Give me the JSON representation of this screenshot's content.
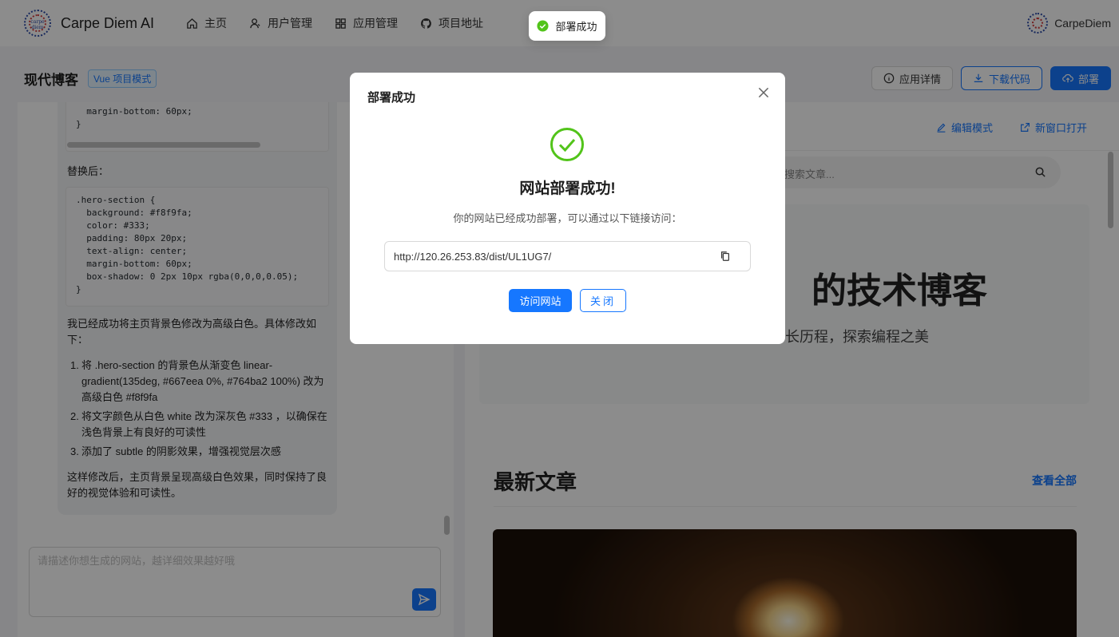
{
  "header": {
    "logo_text": "carpe diem",
    "brand": "Carpe Diem AI",
    "nav": [
      {
        "label": "主页",
        "icon": "home-icon"
      },
      {
        "label": "用户管理",
        "icon": "user-icon"
      },
      {
        "label": "应用管理",
        "icon": "apps-icon"
      },
      {
        "label": "项目地址",
        "icon": "github-icon"
      }
    ],
    "user_name": "CarpeDiem"
  },
  "subbar": {
    "app_title": "现代博客",
    "mode_tag": "Vue 项目模式",
    "details_label": "应用详情",
    "download_label": "下载代码",
    "deploy_label": "部署"
  },
  "chat": {
    "code_top": "  margin-bottom: 60px;\n}",
    "replace_label": "替换后：",
    "code_after": ".hero-section {\n  background: #f8f9fa;\n  color: #333;\n  padding: 80px 20px;\n  text-align: center;\n  margin-bottom: 60px;\n  box-shadow: 0 2px 10px rgba(0,0,0,0.05);\n}",
    "summary": "我已经成功将主页背景色修改为高级白色。具体修改如下：",
    "items": [
      {
        "num": "1.",
        "text": "将 .hero-section 的背景色从渐变色 linear-gradient(135deg, #667eea 0%, #764ba2 100%) 改为高级白色 #f8f9fa"
      },
      {
        "num": "2.",
        "text": "将文字颜色从白色 white 改为深灰色 #333 ，以确保在浅色背景上有良好的可读性"
      },
      {
        "num": "3.",
        "text": "添加了 subtle 的阴影效果，增强视觉层次感"
      }
    ],
    "conclusion": "这样修改后，主页背景呈现高级白色效果，同时保持了良好的视觉体验和可读性。",
    "input_placeholder": "请描述你想生成的网站，越详细效果越好哦"
  },
  "preview": {
    "edit_mode_label": "编辑模式",
    "open_new_label": "新窗口打开",
    "search_placeholder": "搜索文章...",
    "hero_title": "的技术博客",
    "hero_sub": "长历程，探索编程之美",
    "section_title": "最新文章",
    "view_all": "查看全部"
  },
  "modal": {
    "title": "部署成功",
    "heading": "网站部署成功!",
    "description": "你的网站已经成功部署，可以通过以下链接访问：",
    "url": "http://120.26.253.83/dist/UL1UG7/",
    "visit_label": "访问网站",
    "close_label": "关闭"
  },
  "toast": {
    "message": "部署成功"
  },
  "colors": {
    "primary": "#1677ff",
    "success": "#52c41a"
  }
}
